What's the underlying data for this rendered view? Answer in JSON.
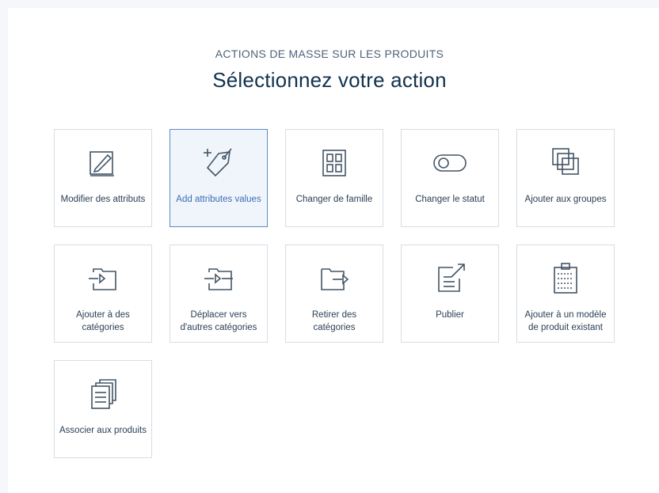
{
  "header": {
    "subtitle": "ACTIONS DE MASSE SUR LES PRODUITS",
    "title": "Sélectionnez votre action"
  },
  "actions": [
    {
      "label": "Modifier des attributs",
      "icon": "edit-attributes-icon",
      "selected": false
    },
    {
      "label": "Add attributes values",
      "icon": "add-tag-icon",
      "selected": true
    },
    {
      "label": "Changer de famille",
      "icon": "family-grid-icon",
      "selected": false
    },
    {
      "label": "Changer le statut",
      "icon": "toggle-icon",
      "selected": false
    },
    {
      "label": "Ajouter aux groupes",
      "icon": "groups-squares-icon",
      "selected": false
    },
    {
      "label": "Ajouter à des catégories",
      "icon": "folder-add-icon",
      "selected": false
    },
    {
      "label": "Déplacer vers d'autres catégories",
      "icon": "folder-move-icon",
      "selected": false
    },
    {
      "label": "Retirer des catégories",
      "icon": "folder-remove-icon",
      "selected": false
    },
    {
      "label": "Publier",
      "icon": "publish-icon",
      "selected": false
    },
    {
      "label": "Ajouter à un modèle de produit existant",
      "icon": "product-model-icon",
      "selected": false
    },
    {
      "label": "Associer aux produits",
      "icon": "associate-products-icon",
      "selected": false
    }
  ],
  "colors": {
    "accent": "#5d8bc5",
    "text": "#11324d",
    "border": "#d8dce5"
  }
}
